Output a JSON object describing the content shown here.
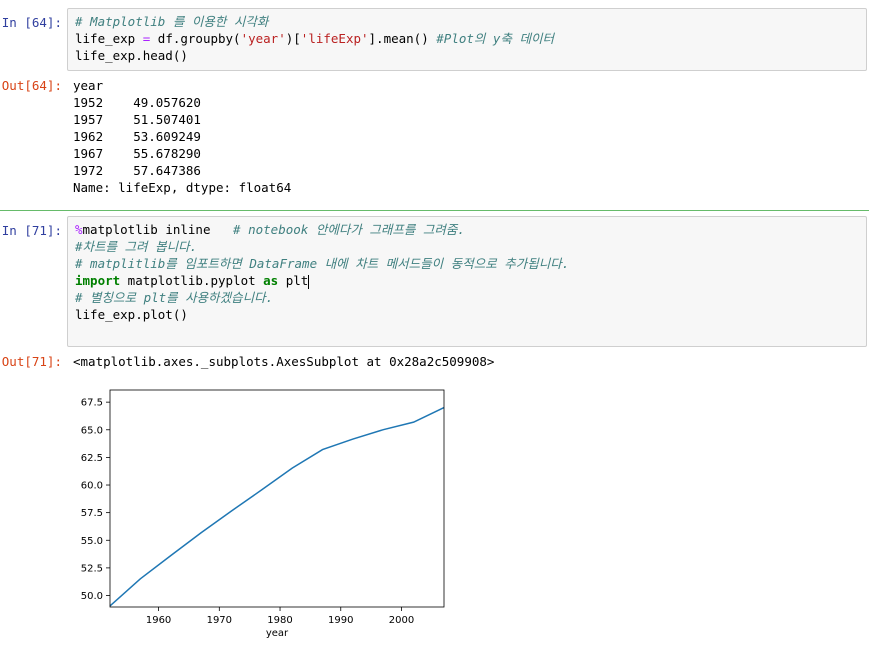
{
  "cells": [
    {
      "in_prompt": "In [64]:",
      "code": {
        "line1": "# Matplotlib 를 이용한 시각화",
        "line2_a": "life_exp ",
        "line2_eq": "=",
        "line2_b": " df.groupby(",
        "line2_str1": "'year'",
        "line2_c": ")[",
        "line2_str2": "'lifeExp'",
        "line2_d": "].mean() ",
        "line2_cm": "#Plot의 y축 데이터",
        "line3": "life_exp.head()"
      },
      "out_prompt": "Out[64]:",
      "output": [
        "year",
        "1952    49.057620",
        "1957    51.507401",
        "1962    53.609249",
        "1967    55.678290",
        "1972    57.647386",
        "Name: lifeExp, dtype: float64"
      ]
    },
    {
      "in_prompt": "In [71]:",
      "code": {
        "line1_magic": "%",
        "line1_text": "matplotlib inline   ",
        "line1_cm": "# notebook 안에다가 그래프를 그려줌.",
        "line2": "#차트를 그려 봅니다.",
        "line3": "# matplitlib를 임포트하면 DataFrame 내에 차트 메서드들이 동적으로 추가됩니다.",
        "line4_kw1": "import",
        "line4_a": " matplotlib.pyplot ",
        "line4_kw2": "as",
        "line4_b": " plt",
        "line5": "# 별칭으로 plt를 사용하겠습니다.",
        "line6": "life_exp.plot()"
      },
      "out_prompt": "Out[71]:",
      "output_text": "<matplotlib.axes._subplots.AxesSubplot at 0x28a2c509908>"
    }
  ],
  "chart_data": {
    "type": "line",
    "title": "",
    "xlabel": "year",
    "ylabel": "",
    "x": [
      1952,
      1957,
      1962,
      1967,
      1972,
      1977,
      1982,
      1987,
      1992,
      1997,
      2002,
      2007
    ],
    "series": [
      {
        "values": [
          49.06,
          51.51,
          53.61,
          55.68,
          57.65,
          59.57,
          61.53,
          63.21,
          64.16,
          65.01,
          65.69,
          67.01
        ],
        "color": "#1f77b4"
      }
    ],
    "xlim": [
      1952,
      2007
    ],
    "ylim": [
      48.96,
      68.6
    ],
    "xticks": [
      1960,
      1970,
      1980,
      1990,
      2000
    ],
    "yticks": [
      50.0,
      52.5,
      55.0,
      57.5,
      60.0,
      62.5,
      65.0,
      67.5
    ],
    "ytick_labels": [
      "50.0",
      "52.5",
      "55.0",
      "57.5",
      "60.0",
      "62.5",
      "65.0",
      "67.5"
    ],
    "grid": false
  }
}
